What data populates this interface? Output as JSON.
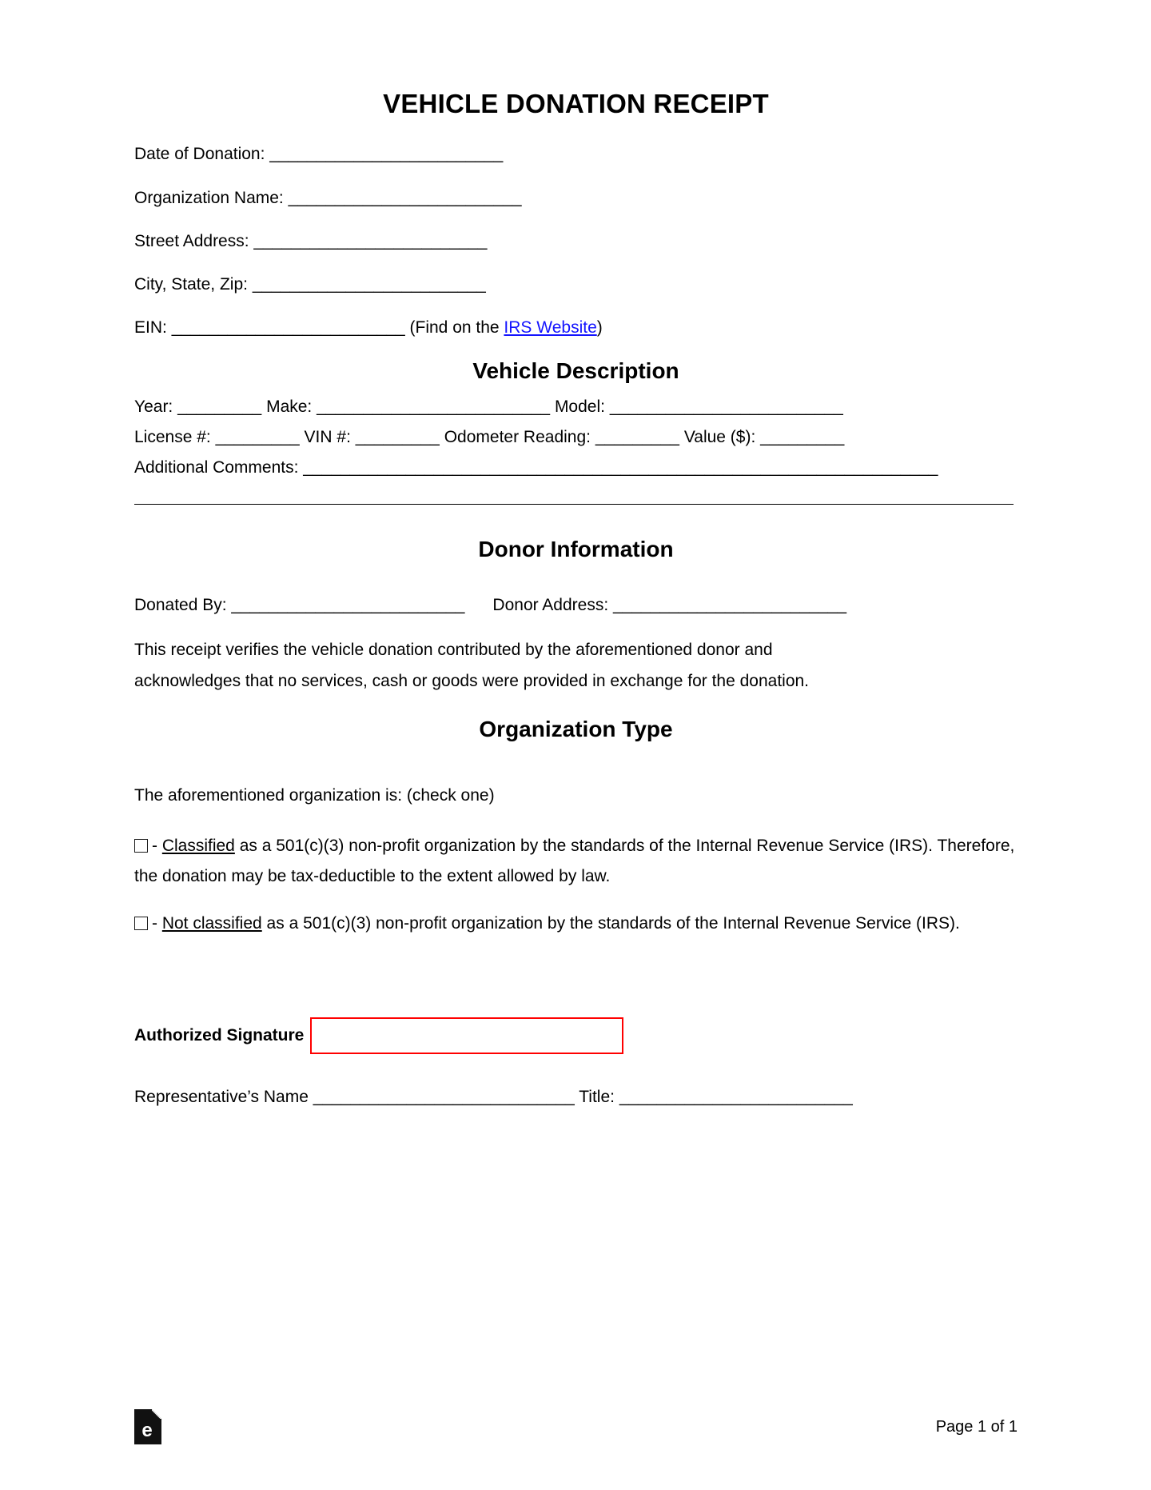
{
  "document": {
    "title": "VEHICLE DONATION RECEIPT"
  },
  "header_fields": {
    "date_of_donation": {
      "label": "Date of Donation:",
      "blank": "_________________________"
    },
    "organization_name": {
      "label": "Organization Name:",
      "blank": "_________________________"
    },
    "street_address": {
      "label": "Street Address:",
      "blank": "_________________________"
    },
    "city_state_zip": {
      "label": "City, State, Zip:",
      "blank": "_________________________"
    },
    "ein": {
      "label": "EIN:",
      "blank": "_________________________",
      "hint_prefix": "(Find on the ",
      "link_text": "IRS Website",
      "hint_suffix": ")",
      "link_color": "#1414ff"
    }
  },
  "vehicle_description": {
    "heading": "Vehicle Description",
    "line1": {
      "year_label": "Year:",
      "year_blank": "_________",
      "make_label": "Make:",
      "make_blank": "_________________________",
      "model_label": "Model:",
      "model_blank": "_________________________"
    },
    "line2": {
      "license_label": "License #:",
      "license_blank": "_________",
      "vin_label": "VIN #:",
      "vin_blank": "_________",
      "odometer_label": "Odometer Reading:",
      "odometer_blank": "_________",
      "value_label": "Value ($):",
      "value_blank": "_________"
    },
    "comments": {
      "label": "Additional Comments:",
      "blank": "____________________________________________________________________"
    }
  },
  "donor_information": {
    "heading": "Donor Information",
    "donated_by_label": "Donated By:",
    "donated_by_blank": "_________________________",
    "donor_address_label": "Donor Address:",
    "donor_address_blank": "_________________________",
    "statement_line1": "This receipt verifies the vehicle donation contributed by the aforementioned donor and",
    "statement_line2": "acknowledges that no services, cash or goods were provided in exchange for the donation."
  },
  "organization_type": {
    "heading": "Organization Type",
    "instruction": "The aforementioned organization is: (check one)",
    "options": [
      {
        "checkbox": "☐",
        "dash": "- ",
        "emphasis": "Classified",
        "text": " as a 501(c)(3) non-profit organization by the standards of the Internal Revenue Service (IRS). Therefore, the donation may be tax-deductible to the extent allowed by law."
      },
      {
        "checkbox": "☐",
        "dash": "- ",
        "emphasis": "Not classified",
        "text": " as a 501(c)(3) non-profit organization by the standards of the Internal Revenue Service (IRS)."
      }
    ]
  },
  "signature": {
    "label": "Authorized Signature",
    "box_value": "",
    "box_border_color": "#ff0000",
    "representative_label": "Representative’s Name",
    "representative_blank": "____________________________",
    "title_label": "Title:",
    "title_blank": "_________________________"
  },
  "footer": {
    "logo_letter": "e",
    "logo_name": "eforms-logo",
    "page_number": "Page 1 of 1"
  }
}
